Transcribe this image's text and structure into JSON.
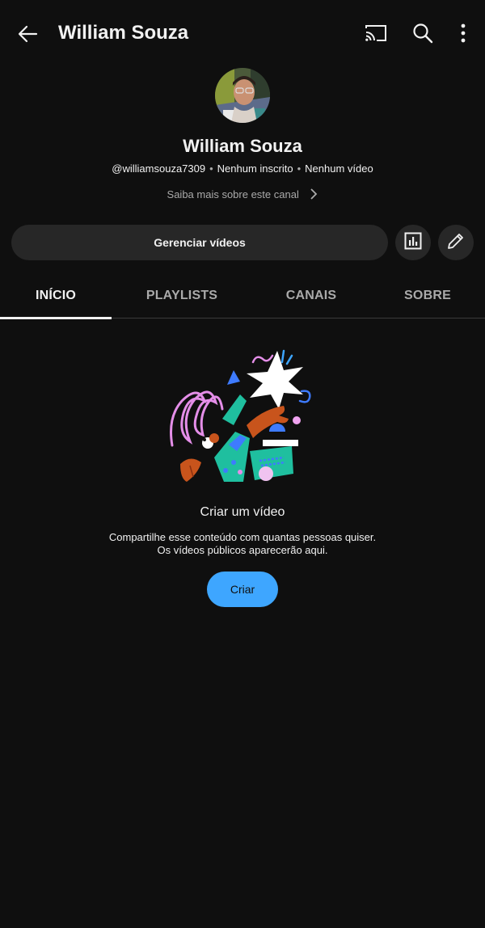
{
  "header": {
    "title": "William Souza",
    "back_icon": "arrow-left-icon",
    "cast_icon": "cast-icon",
    "search_icon": "search-icon",
    "more_icon": "more-vertical-icon"
  },
  "channel": {
    "name": "William Souza",
    "handle": "@williamsouza7309",
    "subscribers": "Nenhum inscrito",
    "videos": "Nenhum vídeo",
    "about_link": "Saiba mais sobre este canal"
  },
  "actions": {
    "manage_label": "Gerenciar vídeos",
    "analytics_icon": "analytics-icon",
    "edit_icon": "pencil-icon"
  },
  "tabs": [
    {
      "label": "INÍCIO",
      "active": true
    },
    {
      "label": "PLAYLISTS",
      "active": false
    },
    {
      "label": "CANAIS",
      "active": false
    },
    {
      "label": "SOBRE",
      "active": false
    }
  ],
  "empty_state": {
    "title": "Criar um vídeo",
    "line1": "Compartilhe esse conteúdo com quantas pessoas quiser.",
    "line2": "Os vídeos públicos aparecerão aqui.",
    "button_label": "Criar"
  },
  "colors": {
    "background": "#0f0f0f",
    "surface": "#272727",
    "accent": "#3ea6ff",
    "text_primary": "#f1f1f1",
    "text_secondary": "#aaaaaa"
  }
}
